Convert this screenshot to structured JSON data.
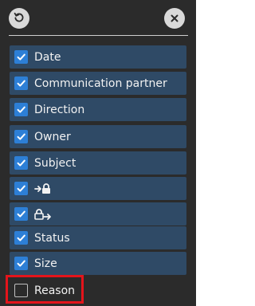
{
  "header": {
    "reset_icon": "refresh-icon",
    "close_icon": "close-icon"
  },
  "columns": [
    {
      "label": "Date",
      "checked": true
    },
    {
      "label": "Communication partner",
      "checked": true
    },
    {
      "label": "Direction",
      "checked": true
    },
    {
      "label": "Owner",
      "checked": true
    },
    {
      "label": "Subject",
      "checked": true
    },
    {
      "label": "",
      "icon": "attachment-lock-icon",
      "checked": true
    },
    {
      "label": "",
      "icon": "lock-arrow-icon",
      "checked": true
    },
    {
      "label": "Status",
      "checked": true
    },
    {
      "label": "Size",
      "checked": true
    },
    {
      "label": "Reason",
      "checked": false
    }
  ],
  "colors": {
    "panel_background": "#2b2b2b",
    "row_background": "#2f4a66",
    "checkbox_checked": "#2d7fd6",
    "highlight": "#e3141b"
  }
}
